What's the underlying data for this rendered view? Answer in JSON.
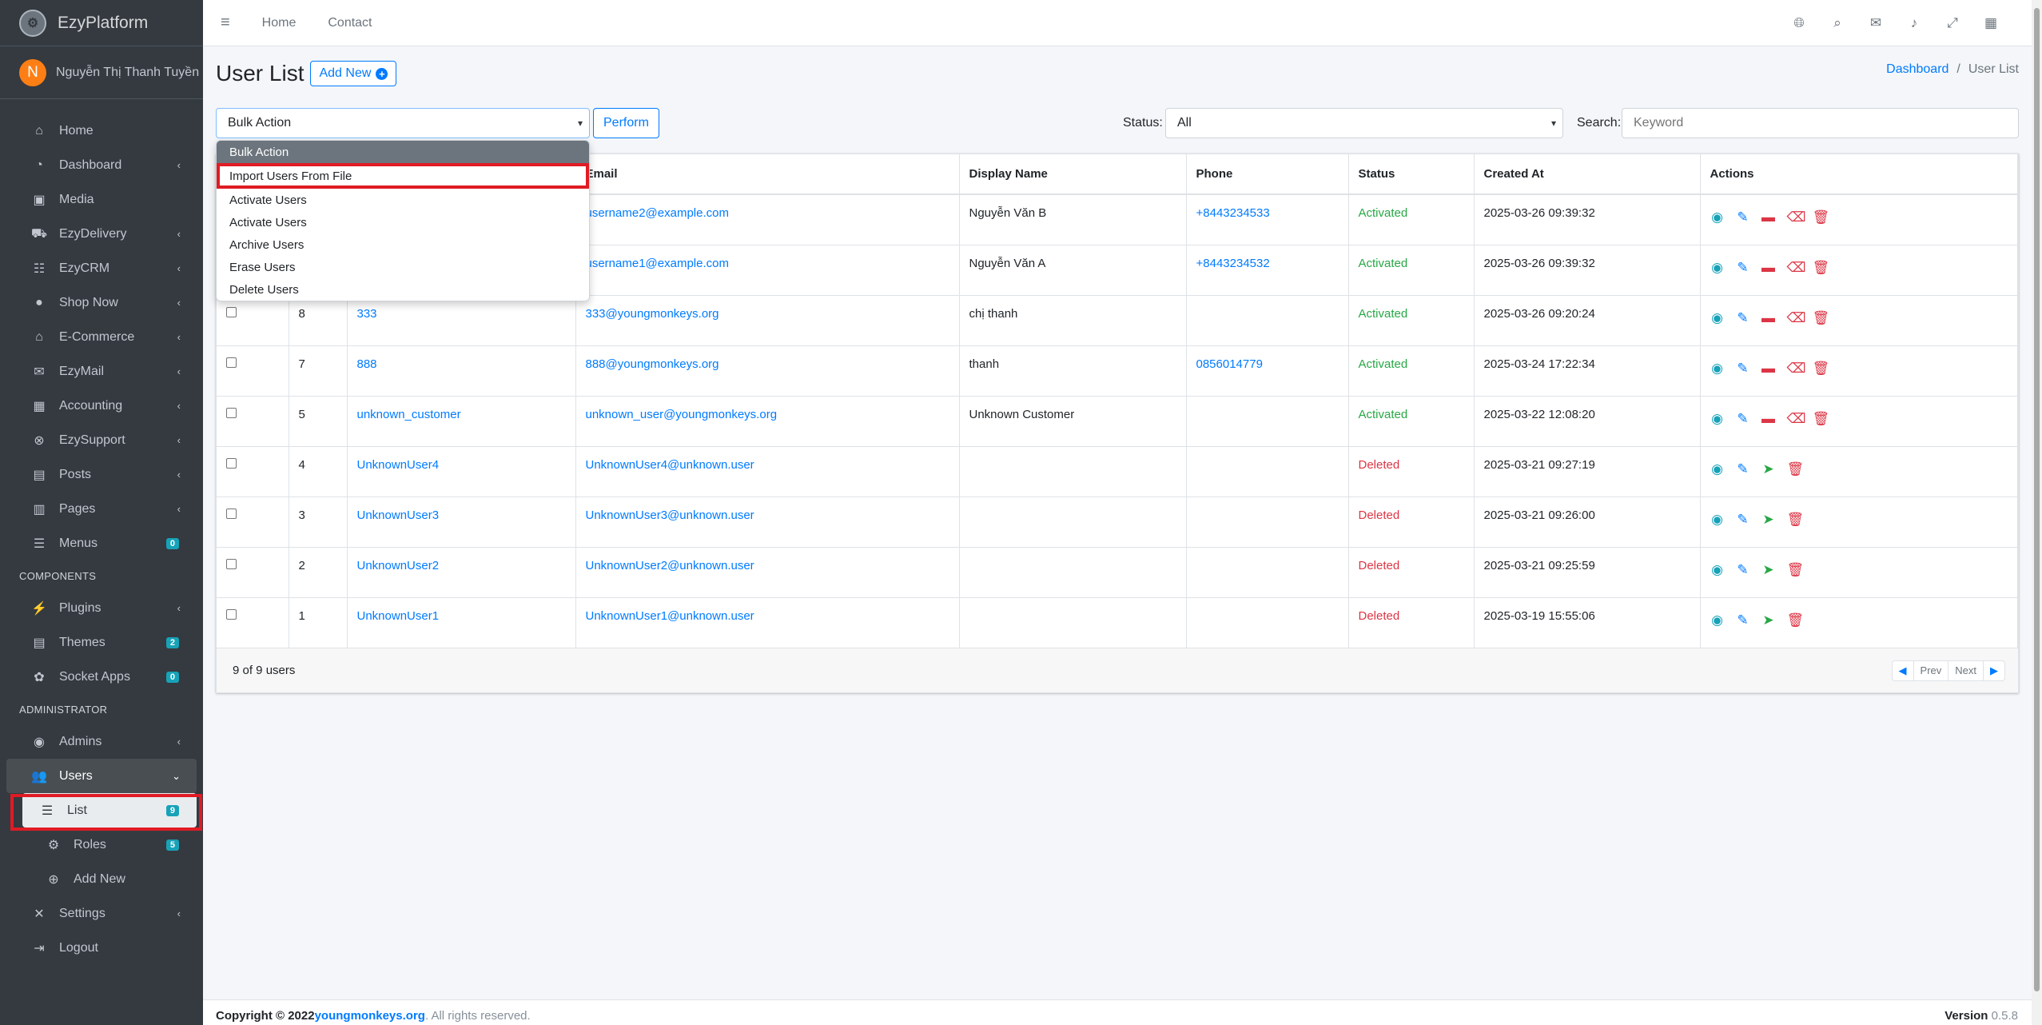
{
  "brand": {
    "name": "EzyPlatform",
    "logo_icon": "gear-logo"
  },
  "user": {
    "initial": "N",
    "name": "Nguyễn Thị Thanh Tuyền"
  },
  "sidebar": {
    "items": [
      {
        "label": "Home",
        "icon": "home-icon",
        "glyph": "⌂"
      },
      {
        "label": "Dashboard",
        "icon": "dashboard-icon",
        "glyph": "◔",
        "chevron": "‹"
      },
      {
        "label": "Media",
        "icon": "media-icon",
        "glyph": "▣"
      },
      {
        "label": "EzyDelivery",
        "icon": "truck-icon",
        "glyph": "⛟",
        "chevron": "‹"
      },
      {
        "label": "EzyCRM",
        "icon": "crm-icon",
        "glyph": "☷",
        "chevron": "‹"
      },
      {
        "label": "Shop Now",
        "icon": "shop-icon",
        "glyph": "●",
        "chevron": "‹"
      },
      {
        "label": "E-Commerce",
        "icon": "store-icon",
        "glyph": "⌂",
        "chevron": "‹"
      },
      {
        "label": "EzyMail",
        "icon": "mail-icon",
        "glyph": "✉",
        "chevron": "‹"
      },
      {
        "label": "Accounting",
        "icon": "calculator-icon",
        "glyph": "▦",
        "chevron": "‹"
      },
      {
        "label": "EzySupport",
        "icon": "support-icon",
        "glyph": "⊗",
        "chevron": "‹"
      },
      {
        "label": "Posts",
        "icon": "posts-icon",
        "glyph": "▤",
        "chevron": "‹"
      },
      {
        "label": "Pages",
        "icon": "pages-icon",
        "glyph": "▥",
        "chevron": "‹"
      },
      {
        "label": "Menus",
        "icon": "menu-icon",
        "glyph": "☰",
        "badge": "0"
      }
    ],
    "components_header": "COMPONENTS",
    "components": [
      {
        "label": "Plugins",
        "icon": "plug-icon",
        "glyph": "⚡",
        "chevron": "‹"
      },
      {
        "label": "Themes",
        "icon": "themes-icon",
        "glyph": "▤",
        "badge": "2"
      },
      {
        "label": "Socket Apps",
        "icon": "socket-icon",
        "glyph": "✿",
        "badge": "0"
      }
    ],
    "admin_header": "ADMINISTRATOR",
    "admins": {
      "label": "Admins",
      "icon": "user-circle-icon",
      "glyph": "◉",
      "chevron": "‹"
    },
    "users": {
      "label": "Users",
      "icon": "users-icon",
      "glyph": "👥",
      "chevron": "⌄"
    },
    "users_list": {
      "label": "List",
      "icon": "list-icon",
      "glyph": "☰",
      "badge": "9"
    },
    "users_roles": {
      "label": "Roles",
      "icon": "roles-icon",
      "glyph": "⚙",
      "badge": "5"
    },
    "users_add": {
      "label": "Add New",
      "icon": "plus-circle-icon",
      "glyph": "⊕"
    },
    "settings": {
      "label": "Settings",
      "icon": "tools-icon",
      "glyph": "✕",
      "chevron": "‹"
    },
    "logout": {
      "label": "Logout",
      "icon": "logout-icon",
      "glyph": "⇥"
    }
  },
  "topbar": {
    "menu_glyph": "≡",
    "links": [
      "Home",
      "Contact"
    ]
  },
  "page": {
    "title": "User List",
    "add_new": "Add New",
    "breadcrumb": {
      "home": "Dashboard",
      "sep": "/",
      "current": "User List"
    }
  },
  "filters": {
    "bulk_selected": "Bulk Action",
    "perform": "Perform",
    "status_label": "Status:",
    "status_selected": "All",
    "search_label": "Search:",
    "search_placeholder": "Keyword"
  },
  "dropdown": {
    "options": [
      "Bulk Action",
      "Import Users From File",
      "Activate Users",
      "Activate Users",
      "Archive Users",
      "Erase Users",
      "Delete Users"
    ]
  },
  "table": {
    "columns": [
      "",
      "",
      "",
      "Email",
      "Display Name",
      "Phone",
      "Status",
      "Created At",
      "Actions"
    ],
    "rows": [
      {
        "id": "",
        "username": "",
        "email": "username2@example.com",
        "display": "Nguyễn Văn B",
        "phone": "+8443234533",
        "status": "Activated",
        "created": "2025-03-26 09:39:32",
        "deleted": false
      },
      {
        "id": "",
        "username": "",
        "email": "username1@example.com",
        "display": "Nguyễn Văn A",
        "phone": "+8443234532",
        "status": "Activated",
        "created": "2025-03-26 09:39:32",
        "deleted": false
      },
      {
        "id": "8",
        "username": "333",
        "email": "333@youngmonkeys.org",
        "display": "chị thanh",
        "phone": "",
        "status": "Activated",
        "created": "2025-03-26 09:20:24",
        "deleted": false
      },
      {
        "id": "7",
        "username": "888",
        "email": "888@youngmonkeys.org",
        "display": "thanh",
        "phone": "0856014779",
        "status": "Activated",
        "created": "2025-03-24 17:22:34",
        "deleted": false
      },
      {
        "id": "5",
        "username": "unknown_customer",
        "email": "unknown_user@youngmonkeys.org",
        "display": "Unknown Customer",
        "phone": "",
        "status": "Activated",
        "created": "2025-03-22 12:08:20",
        "deleted": false
      },
      {
        "id": "4",
        "username": "UnknownUser4",
        "email": "UnknownUser4@unknown.user",
        "display": "",
        "phone": "",
        "status": "Deleted",
        "created": "2025-03-21 09:27:19",
        "deleted": true
      },
      {
        "id": "3",
        "username": "UnknownUser3",
        "email": "UnknownUser3@unknown.user",
        "display": "",
        "phone": "",
        "status": "Deleted",
        "created": "2025-03-21 09:26:00",
        "deleted": true
      },
      {
        "id": "2",
        "username": "UnknownUser2",
        "email": "UnknownUser2@unknown.user",
        "display": "",
        "phone": "",
        "status": "Deleted",
        "created": "2025-03-21 09:25:59",
        "deleted": true
      },
      {
        "id": "1",
        "username": "UnknownUser1",
        "email": "UnknownUser1@unknown.user",
        "display": "",
        "phone": "",
        "status": "Deleted",
        "created": "2025-03-19 15:55:06",
        "deleted": true
      }
    ],
    "count_text": "9 of 9 users",
    "pager": {
      "prev": "Prev",
      "next": "Next"
    }
  },
  "footer": {
    "copyright_prefix": "Copyright © 2022 ",
    "site": "youngmonkeys.org",
    "suffix": ". All rights reserved.",
    "version_label": "Version",
    "version": "0.5.8"
  },
  "colors": {
    "sidebar_bg": "#343a40",
    "primary": "#007bff",
    "success": "#28a745",
    "danger": "#dc3545",
    "info": "#17a2b8",
    "highlight": "#e01b24"
  }
}
